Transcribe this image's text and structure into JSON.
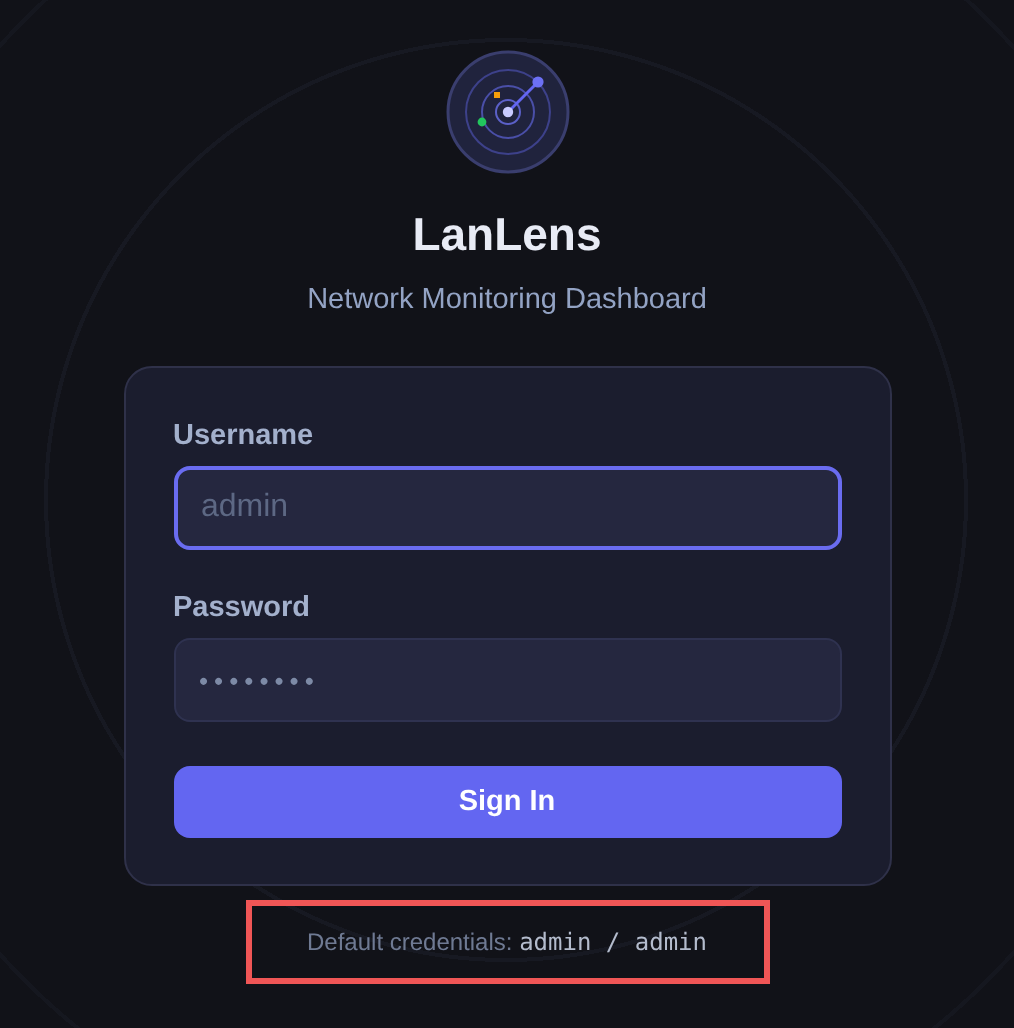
{
  "app": {
    "title": "LanLens",
    "subtitle": "Network Monitoring Dashboard"
  },
  "form": {
    "fields": [
      {
        "label": "Username",
        "kind": "text",
        "placeholder": "admin",
        "focused": true
      },
      {
        "label": "Password",
        "kind": "password",
        "value": "••••••••",
        "focused": false
      }
    ],
    "submit": "Sign In"
  },
  "credentials": {
    "label": "Default credentials:",
    "value": "admin / admin",
    "highlighted": true
  }
}
